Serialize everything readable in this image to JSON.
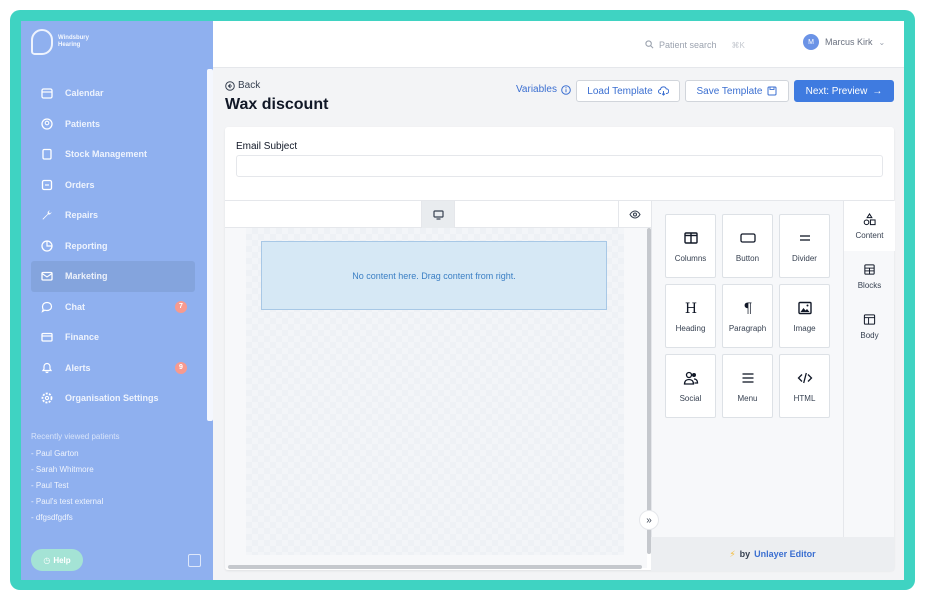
{
  "brand": {
    "name_line1": "Windsbury",
    "name_line2": "Hearing"
  },
  "sidebar": {
    "items": [
      {
        "label": "Calendar",
        "icon": "calendar-icon"
      },
      {
        "label": "Patients",
        "icon": "patients-icon"
      },
      {
        "label": "Stock Management",
        "icon": "stock-icon"
      },
      {
        "label": "Orders",
        "icon": "orders-icon"
      },
      {
        "label": "Repairs",
        "icon": "wrench-icon"
      },
      {
        "label": "Reporting",
        "icon": "chart-icon"
      },
      {
        "label": "Marketing",
        "icon": "mail-icon",
        "active": true
      },
      {
        "label": "Chat",
        "icon": "chat-icon",
        "badge": "7"
      },
      {
        "label": "Finance",
        "icon": "card-icon"
      },
      {
        "label": "Alerts",
        "icon": "bell-icon",
        "badge": "9"
      },
      {
        "label": "Organisation Settings",
        "icon": "gear-icon"
      }
    ],
    "recent_title": "Recently viewed patients",
    "recent": [
      "- Paul Garton",
      "- Sarah Whitmore",
      "- Paul Test",
      "- Paul's test external",
      "- dfgsdfgdfs"
    ],
    "help_label": "Help"
  },
  "topbar": {
    "search_placeholder": "Patient search",
    "search_shortcut": "⌘K",
    "user_initial": "M",
    "user_name": "Marcus Kirk"
  },
  "header": {
    "back_label": "Back",
    "title": "Wax discount",
    "variables_label": "Variables",
    "load_label": "Load Template",
    "save_label": "Save Template",
    "next_label": "Next: Preview"
  },
  "form": {
    "subject_label": "Email Subject",
    "subject_value": ""
  },
  "editor": {
    "empty_text": "No content here. Drag content from right.",
    "tools": [
      {
        "label": "Columns",
        "icon": "columns-icon"
      },
      {
        "label": "Button",
        "icon": "button-icon"
      },
      {
        "label": "Divider",
        "icon": "divider-icon"
      },
      {
        "label": "Heading",
        "icon": "heading-icon"
      },
      {
        "label": "Paragraph",
        "icon": "paragraph-icon"
      },
      {
        "label": "Image",
        "icon": "image-icon"
      },
      {
        "label": "Social",
        "icon": "social-icon"
      },
      {
        "label": "Menu",
        "icon": "menu-icon"
      },
      {
        "label": "HTML",
        "icon": "code-icon"
      }
    ],
    "tabs": [
      {
        "label": "Content",
        "active": true
      },
      {
        "label": "Blocks"
      },
      {
        "label": "Body"
      }
    ],
    "footer_prefix": "by",
    "footer_brand": "Unlayer Editor"
  },
  "colors": {
    "accent": "#3f7be0",
    "sidebar": "#8fb0ef",
    "frame": "#3fd3c2"
  }
}
